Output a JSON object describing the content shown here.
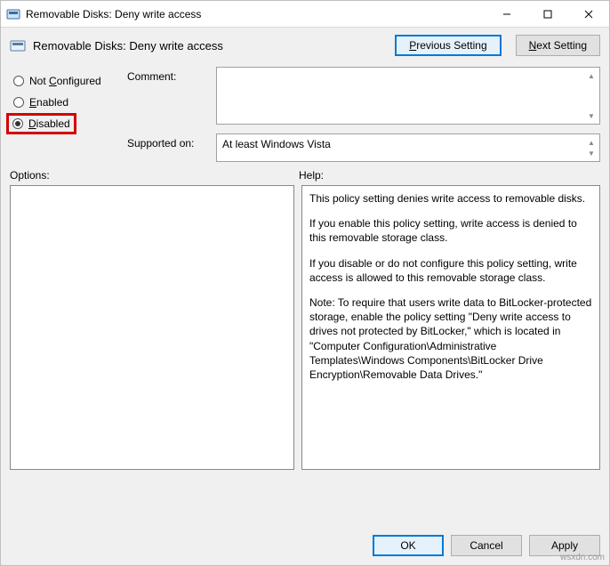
{
  "window": {
    "title": "Removable Disks: Deny write access"
  },
  "subheader": {
    "title": "Removable Disks: Deny write access",
    "prev": "Previous Setting",
    "next": "Next Setting"
  },
  "radios": {
    "not_configured": "Not Configured",
    "enabled": "Enabled",
    "disabled": "Disabled",
    "selected": "disabled"
  },
  "fields": {
    "comment_label": "Comment:",
    "comment_value": "",
    "supported_label": "Supported on:",
    "supported_value": "At least Windows Vista"
  },
  "panels": {
    "options_label": "Options:",
    "help_label": "Help:"
  },
  "help": {
    "p1": "This policy setting denies write access to removable disks.",
    "p2": "If you enable this policy setting, write access is denied to this removable storage class.",
    "p3": "If you disable or do not configure this policy setting, write access is allowed to this removable storage class.",
    "p4": "Note: To require that users write data to BitLocker-protected storage, enable the policy setting \"Deny write access to drives not protected by BitLocker,\" which is located in \"Computer Configuration\\Administrative Templates\\Windows Components\\BitLocker Drive Encryption\\Removable Data Drives.\""
  },
  "footer": {
    "ok": "OK",
    "cancel": "Cancel",
    "apply": "Apply"
  },
  "watermark": "wsxdn.com"
}
